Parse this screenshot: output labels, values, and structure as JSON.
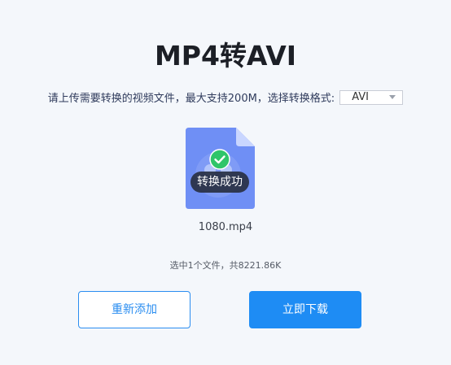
{
  "page": {
    "title": "MP4转AVI",
    "instruction": "请上传需要转换的视频文件，最大支持200M，选择转换格式:",
    "format_select": {
      "selected": "AVI"
    }
  },
  "file": {
    "name": "1080.mp4",
    "status_badge": "转换成功"
  },
  "summary": "选中1个文件，共8221.86K",
  "buttons": {
    "readd": "重新添加",
    "download": "立即下载"
  },
  "colors": {
    "accent": "#1e8cf4",
    "success": "#2ecc71",
    "file_icon": "#6f8ff5"
  }
}
